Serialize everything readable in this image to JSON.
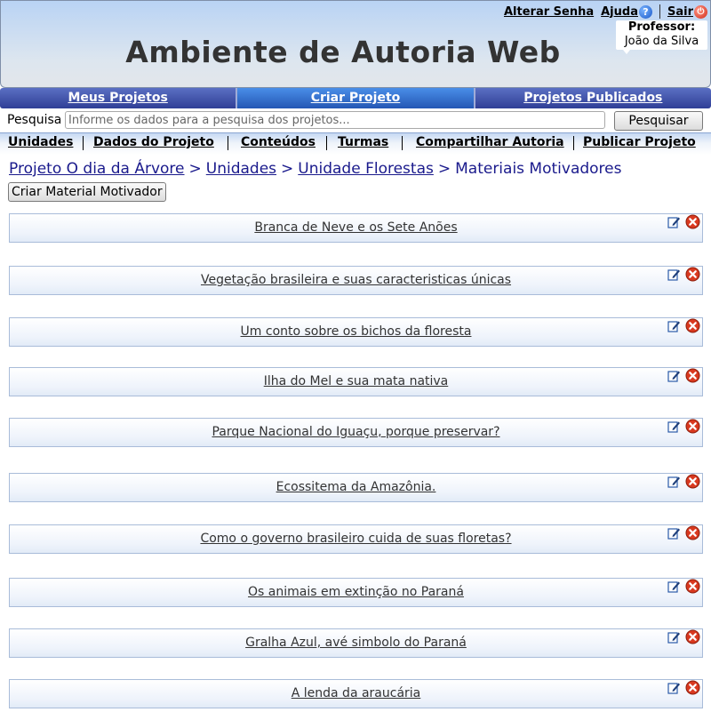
{
  "header": {
    "title": "Ambiente de Autoria Web",
    "links": {
      "change_password": "Alterar Senha",
      "help": "Ajuda",
      "exit": "Sair"
    },
    "user": {
      "role": "Professor:",
      "name": "João da Silva"
    }
  },
  "main_nav": {
    "tabs": [
      "Meus Projetos",
      "Criar Projeto",
      "Projetos Publicados"
    ],
    "active": "Criar Projeto"
  },
  "search": {
    "label": "Pesquisa",
    "placeholder": "Informe os dados para a pesquisa dos projetos...",
    "button": "Pesquisar"
  },
  "sub_nav": [
    "Unidades",
    "Dados do Projeto",
    "Conteúdos",
    "Turmas",
    "Compartilhar Autoria",
    "Publicar Projeto"
  ],
  "breadcrumb": {
    "project": "Projeto O dia da Árvore",
    "units": "Unidades",
    "unit": "Unidade Florestas",
    "current": "Materiais Motivadores",
    "separator": ">"
  },
  "create_button": "Criar Material Motivador",
  "materials": [
    "Branca de Neve e os Sete Anões",
    "Vegetação brasileira e suas caracteristicas únicas",
    "Um conto sobre os bichos da floresta",
    "Ilha do Mel e sua mata nativa",
    "Parque Nacional do Iguaçu, porque preservar?",
    "Ecossitema da Amazônia.",
    "Como o governo brasileiro cuida de suas floretas?",
    "Os animais em extinção no Paraná",
    "Gralha Azul, avé simbolo do Paraná",
    "A lenda da araucária"
  ],
  "icons": {
    "edit": "edit-icon",
    "delete": "delete-icon",
    "help": "help-icon",
    "exit": "power-icon"
  },
  "colors": {
    "nav_bar": "#2f3f96",
    "nav_active": "#2457b4",
    "breadcrumb": "#1a1a8c",
    "delete": "#d22a16"
  }
}
